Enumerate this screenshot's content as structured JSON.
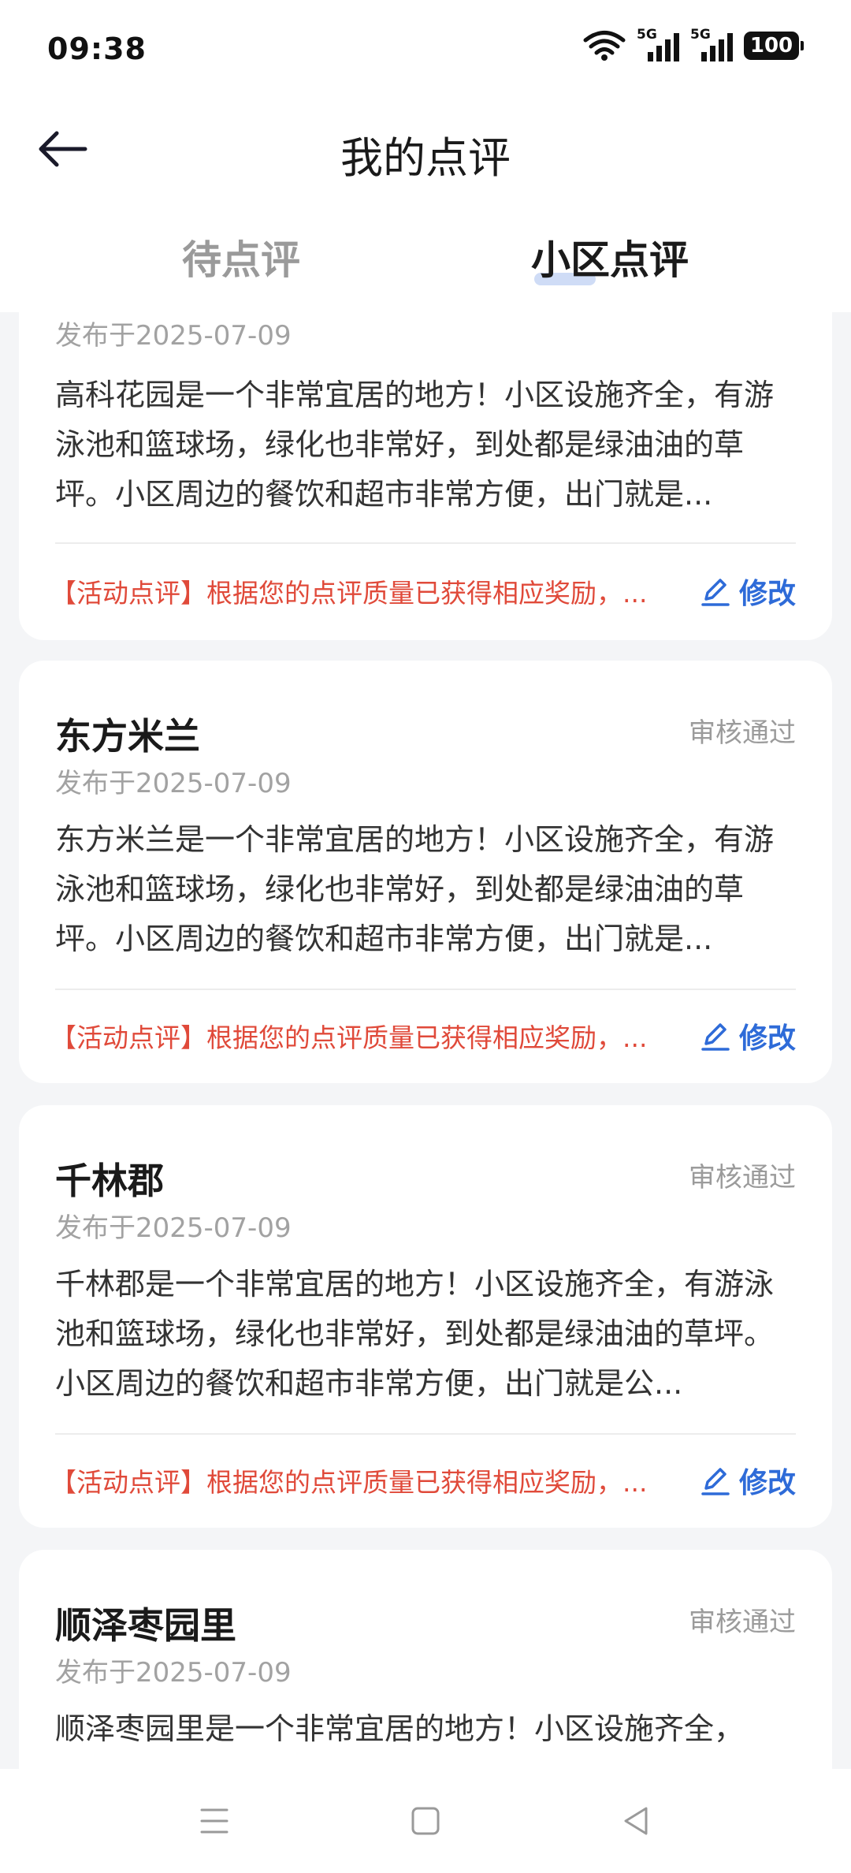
{
  "status_bar": {
    "time": "09:38",
    "signal_1_label": "5G",
    "signal_2_label": "5G",
    "battery": "100"
  },
  "header": {
    "title": "我的点评",
    "back_icon": "arrow-left-icon"
  },
  "tabs": [
    {
      "label": "待点评",
      "active": false
    },
    {
      "label": "小区点评",
      "active": true
    }
  ],
  "accent_color": "#2e6bd8",
  "reward_color": "#e04a3a",
  "reviews": [
    {
      "name": "",
      "status": "",
      "date": "发布于2025-07-09",
      "text": "高科花园是一个非常宜居的地方！小区设施齐全，有游泳池和篮球场，绿化也非常好，到处都是绿油油的草坪。小区周边的餐饮和超市非常方便，出门就是...",
      "reward": "【活动点评】根据您的点评质量已获得相应奖励，...",
      "edit_label": "修改"
    },
    {
      "name": "东方米兰",
      "status": "审核通过",
      "date": "发布于2025-07-09",
      "text": "东方米兰是一个非常宜居的地方！小区设施齐全，有游泳池和篮球场，绿化也非常好，到处都是绿油油的草坪。小区周边的餐饮和超市非常方便，出门就是...",
      "reward": "【活动点评】根据您的点评质量已获得相应奖励，...",
      "edit_label": "修改"
    },
    {
      "name": "千林郡",
      "status": "审核通过",
      "date": "发布于2025-07-09",
      "text": "千林郡是一个非常宜居的地方！小区设施齐全，有游泳池和篮球场，绿化也非常好，到处都是绿油油的草坪。小区周边的餐饮和超市非常方便，出门就是公...",
      "reward": "【活动点评】根据您的点评质量已获得相应奖励，...",
      "edit_label": "修改"
    },
    {
      "name": "顺泽枣园里",
      "status": "审核通过",
      "date": "发布于2025-07-09",
      "text": "顺泽枣园里是一个非常宜居的地方！小区设施齐全，"
    }
  ],
  "bottom_nav": {
    "menu_icon": "menu-icon",
    "home_icon": "home-icon",
    "back_icon": "back-triangle-icon"
  }
}
